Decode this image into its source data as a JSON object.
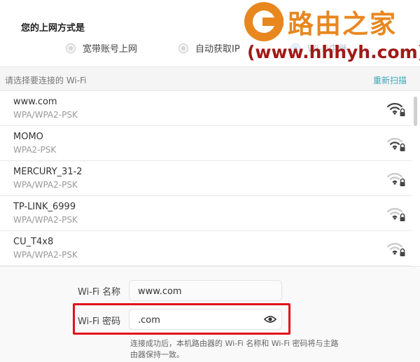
{
  "connection": {
    "title": "您的上网方式是",
    "options": [
      {
        "label": "宽带账号上网"
      },
      {
        "label": "自动获取IP"
      },
      {
        "label": "Wi-Fi中继"
      }
    ]
  },
  "watermark": {
    "name": "路由之家",
    "url": "(www.hhhyh.com)"
  },
  "wifi_list": {
    "hint": "请选择要连接的 Wi-Fi",
    "rescan": "重新扫描",
    "networks": [
      {
        "ssid": "www.com",
        "security": "WPA/WPA2-PSK",
        "signal_bars": 3
      },
      {
        "ssid": "MOMO",
        "security": "WPA2-PSK",
        "signal_bars": 2
      },
      {
        "ssid": "MERCURY_31-2",
        "security": "WPA/WPA2-PSK",
        "signal_bars": 1
      },
      {
        "ssid": "TP-LINK_6999",
        "security": "WPA/WPA2-PSK",
        "signal_bars": 1
      },
      {
        "ssid": "CU_T4x8",
        "security": "WPA/WPA2-PSK",
        "signal_bars": 1
      }
    ]
  },
  "form": {
    "name_label": "Wi-Fi 名称",
    "name_value": "www.com",
    "password_label": "Wi-Fi 密码",
    "password_value": ".com",
    "note": "连接成功后，本机路由器的 Wi-Fi 名称和 Wi-Fi 密码将与主路由器保持一致。"
  },
  "colors": {
    "accent": "#3aa6b9",
    "highlight": "#e3111b",
    "brand": "#e8871e",
    "brand_url": "#a01a18"
  },
  "icons": {
    "signal": "wifi-signal-lock-icon",
    "eye": "eye-icon"
  }
}
